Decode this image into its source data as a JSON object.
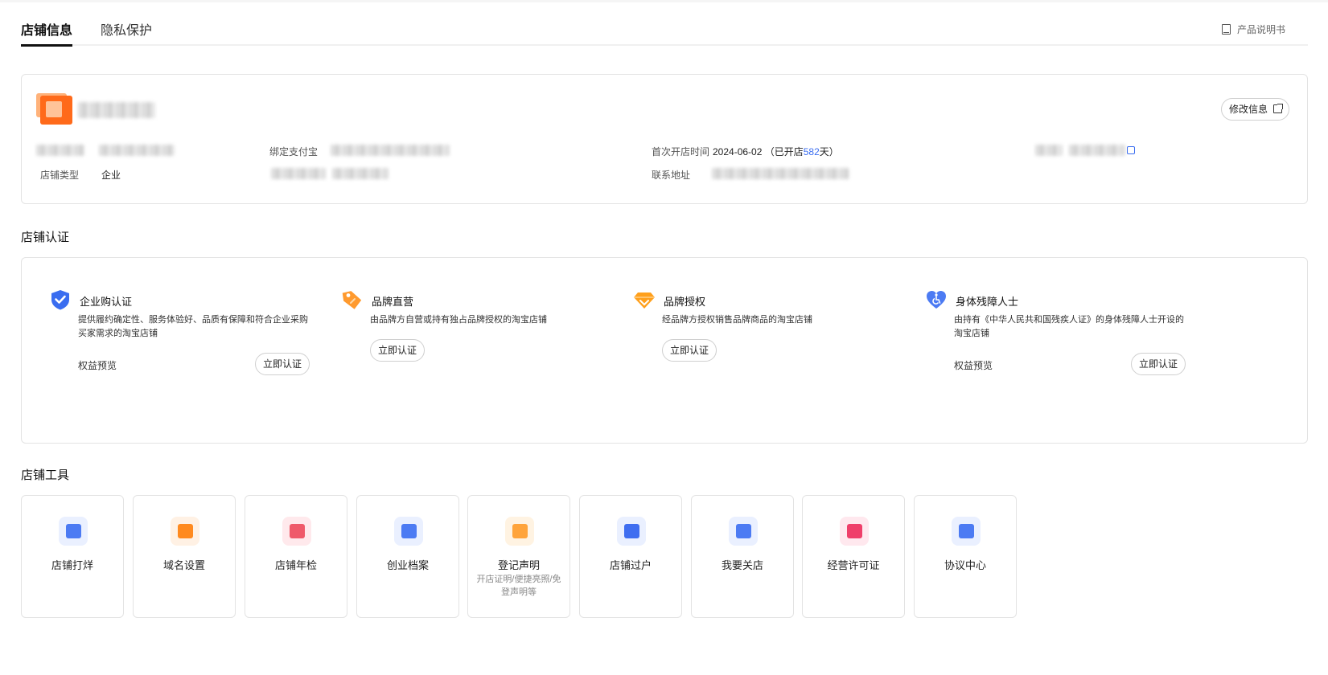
{
  "tabs": [
    {
      "label": "店铺信息",
      "active": true
    },
    {
      "label": "隐私保护",
      "active": false
    }
  ],
  "manual_link": "产品说明书",
  "store_info": {
    "edit_button": "修改信息",
    "alipay_label": "绑定支付宝",
    "store_type_label": "店铺类型",
    "store_type_value": "企业",
    "open_time_label": "首次开店时间",
    "open_date": "2024-06-02",
    "open_prefix": "（已开店",
    "open_days": "582",
    "open_suffix": "天）",
    "address_label": "联系地址"
  },
  "certification": {
    "title": "店铺认证",
    "items": [
      {
        "title": "企业购认证",
        "desc": "提供履约确定性、服务体验好、品质有保障和符合企业采购买家需求的淘宝店铺",
        "rights": "权益预览",
        "button": "立即认证",
        "icon": "blue-shield-check-icon"
      },
      {
        "title": "品牌直营",
        "desc": "由品牌方自营或持有独占品牌授权的淘宝店铺",
        "button": "立即认证",
        "icon": "orange-tag-icon"
      },
      {
        "title": "品牌授权",
        "desc": "经品牌方授权销售品牌商品的淘宝店铺",
        "button": "立即认证",
        "icon": "orange-diamond-icon"
      },
      {
        "title": "身体残障人士",
        "desc": "由持有《中华人民共和国残疾人证》的身体残障人士开设的淘宝店铺",
        "rights": "权益预览",
        "button": "立即认证",
        "icon": "blue-heart-accessibility-icon"
      }
    ]
  },
  "tools": {
    "title": "店铺工具",
    "items": [
      {
        "label": "店铺打烊",
        "color": "#4c7bf3",
        "bg": "#eaf0ff"
      },
      {
        "label": "域名设置",
        "color": "#ff8a1f",
        "bg": "#fff1e4"
      },
      {
        "label": "店铺年检",
        "color": "#ef5a6a",
        "bg": "#ffe9ec"
      },
      {
        "label": "创业档案",
        "color": "#4c7bf3",
        "bg": "#eaf0ff"
      },
      {
        "label": "登记声明",
        "sub": "开店证明/便捷亮照/免登声明等",
        "color": "#ffa43b",
        "bg": "#fff3e2"
      },
      {
        "label": "店铺过户",
        "color": "#3f6ef0",
        "bg": "#eaf0ff"
      },
      {
        "label": "我要关店",
        "color": "#4c7bf3",
        "bg": "#eaf0ff"
      },
      {
        "label": "经营许可证",
        "color": "#ef3f6a",
        "bg": "#ffe8ee"
      },
      {
        "label": "协议中心",
        "color": "#4c7bf3",
        "bg": "#eaf0ff"
      }
    ]
  },
  "colors": {
    "accent_blue": "#3a6df0",
    "brand_orange": "#ff6a1a"
  }
}
